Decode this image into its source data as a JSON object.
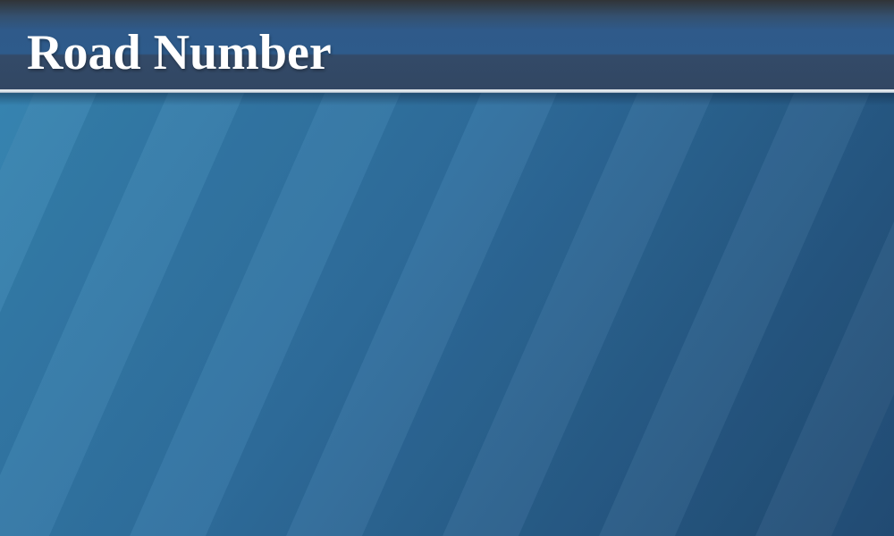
{
  "slide": {
    "title": "Road Number"
  },
  "theme": {
    "header_color": "#2f5a8a",
    "background_light": "#3786b2",
    "background_dark": "#214a72",
    "rule_color": "#eef2f5",
    "title_color": "#ffffff"
  }
}
